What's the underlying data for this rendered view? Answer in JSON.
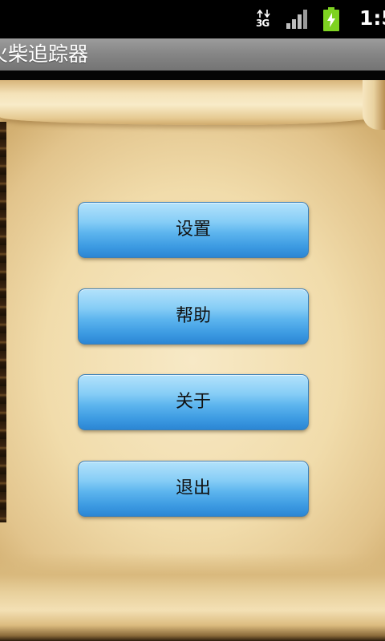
{
  "status_bar": {
    "network_label": "3G",
    "time": "1:5",
    "icons": {
      "network": "network-3g-icon",
      "signal": "signal-strength-icon",
      "battery": "battery-charging-icon"
    }
  },
  "app": {
    "title": "火柴追踪器"
  },
  "menu": {
    "buttons": [
      {
        "label": "设置"
      },
      {
        "label": "帮助"
      },
      {
        "label": "关于"
      },
      {
        "label": "退出"
      }
    ]
  },
  "colors": {
    "status_bar": "#000000",
    "title_bar": "#858585",
    "button_top": "#b3e2fb",
    "button_bottom": "#2b86d4",
    "parchment": "#f1dcab",
    "battery": "#7ed321"
  }
}
